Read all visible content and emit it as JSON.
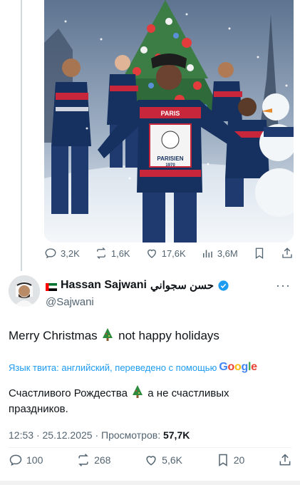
{
  "media": {
    "sweater_text": "PARISIEN",
    "sweater_year": "1970",
    "sweater_band": "PARIS"
  },
  "quoted_actions": [
    {
      "icon": "reply-icon",
      "count": "3,2K"
    },
    {
      "icon": "repost-icon",
      "count": "1,6K"
    },
    {
      "icon": "like-icon",
      "count": "17,6K"
    },
    {
      "icon": "views-icon",
      "count": "3,6M"
    },
    {
      "icon": "bookmark-icon",
      "count": ""
    },
    {
      "icon": "share-icon",
      "count": ""
    }
  ],
  "author": {
    "name": "Hassan Sajwani",
    "arabic_name": "حسن سجواني",
    "handle": "@Sajwani",
    "verified_color": "#1d9bf0"
  },
  "tweet": {
    "text_before": "Merry Christmas",
    "text_after": "not happy holidays",
    "translation_note": "Язык твита: английский, переведено с помощью",
    "google": [
      "G",
      "o",
      "o",
      "g",
      "l",
      "e"
    ],
    "translated_before": "Счастливого Рождества",
    "translated_after": "а не счастливых праздников."
  },
  "meta": {
    "time": "12:53",
    "date": "25.12.2025",
    "views_label": "Просмотров:",
    "views_count": "57,7K"
  },
  "actions": {
    "replies": "100",
    "reposts": "268",
    "likes": "5,6K",
    "bookmarks": "20"
  },
  "colors": {
    "accent": "#1d9bf0",
    "muted": "#536471",
    "text": "#0f1419"
  }
}
